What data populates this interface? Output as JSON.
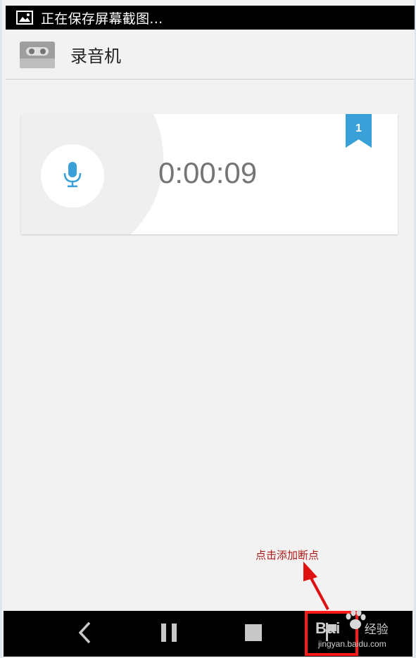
{
  "status_bar": {
    "notification_icon": "image-icon",
    "notification_text": "正在保存屏幕截图..."
  },
  "app_bar": {
    "app_icon": "cassette-icon",
    "title": "录音机"
  },
  "recording_card": {
    "icon": "microphone-icon",
    "elapsed_time": "0:00:09",
    "bookmark_count": "1",
    "accent_color": "#3aa0d8"
  },
  "annotation": {
    "text": "点击添加断点",
    "color": "#b01818"
  },
  "nav_bar": {
    "buttons": [
      "back-icon",
      "pause-icon",
      "stop-icon",
      "add-bookmark-icon"
    ],
    "highlight_color": "#ff1a1a"
  },
  "watermark": {
    "brand": "Bai",
    "brand_suffix": "经验",
    "url": "jingyan.baidu.com"
  }
}
